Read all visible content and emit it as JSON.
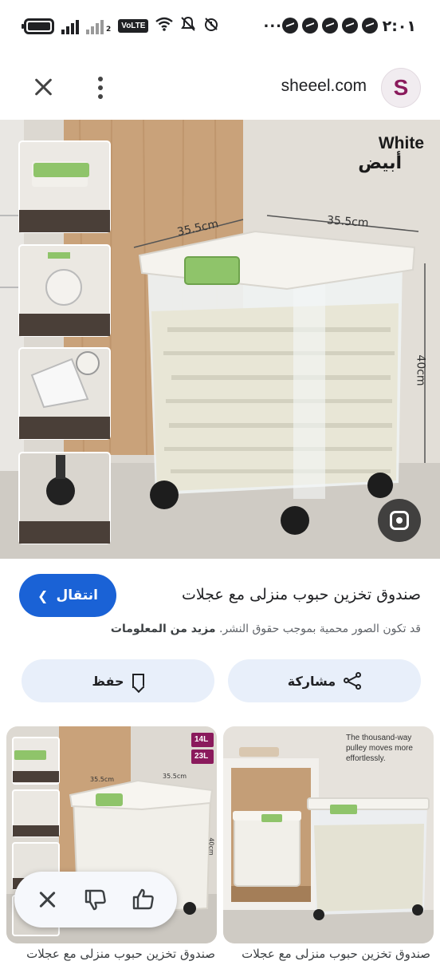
{
  "status_bar": {
    "time": "٢:٠١",
    "ellipsis": "...",
    "network": "VoLTE",
    "sim_label": "2",
    "icons": [
      "battery-icon",
      "signal-icon",
      "signal-dim-icon",
      "volte-icon",
      "wifi-icon",
      "mute-icon",
      "alarm-icon",
      "messenger-icon"
    ]
  },
  "topbar": {
    "domain": "sheeel.com",
    "logo_letter": "S"
  },
  "hero": {
    "variant_en": "White",
    "variant_ar": "أبيض",
    "dim_width_left": "35.5cm",
    "dim_width_right": "35.5cm",
    "dim_height": "40cm"
  },
  "product": {
    "title": "صندوق تخزين حبوب منزلى مع عجلات",
    "visit_label": "انتقال",
    "copyright_text": "قد تكون الصور محمية بموجب حقوق النشر.",
    "more_info": "مزيد من المعلومات"
  },
  "actions": {
    "save_label": "حفظ",
    "share_label": "مشاركة"
  },
  "related": [
    {
      "title": "صندوق تخزين حبوب منزلى مع عجلات",
      "badge_1": "14L",
      "badge_2": "23L",
      "dim_1": "35.5cm",
      "dim_2": "35.5cm",
      "dim_3": "40cm"
    },
    {
      "title": "صندوق تخزين حبوب منزلى مع عجلات",
      "caption": "The thousand-way pulley moves more effortlessly."
    }
  ],
  "colors": {
    "accent_blue": "#1a62d6",
    "chip_bg": "#e8effa",
    "brand_purple": "#8a1a5c",
    "lid_green": "#8fc46a"
  }
}
